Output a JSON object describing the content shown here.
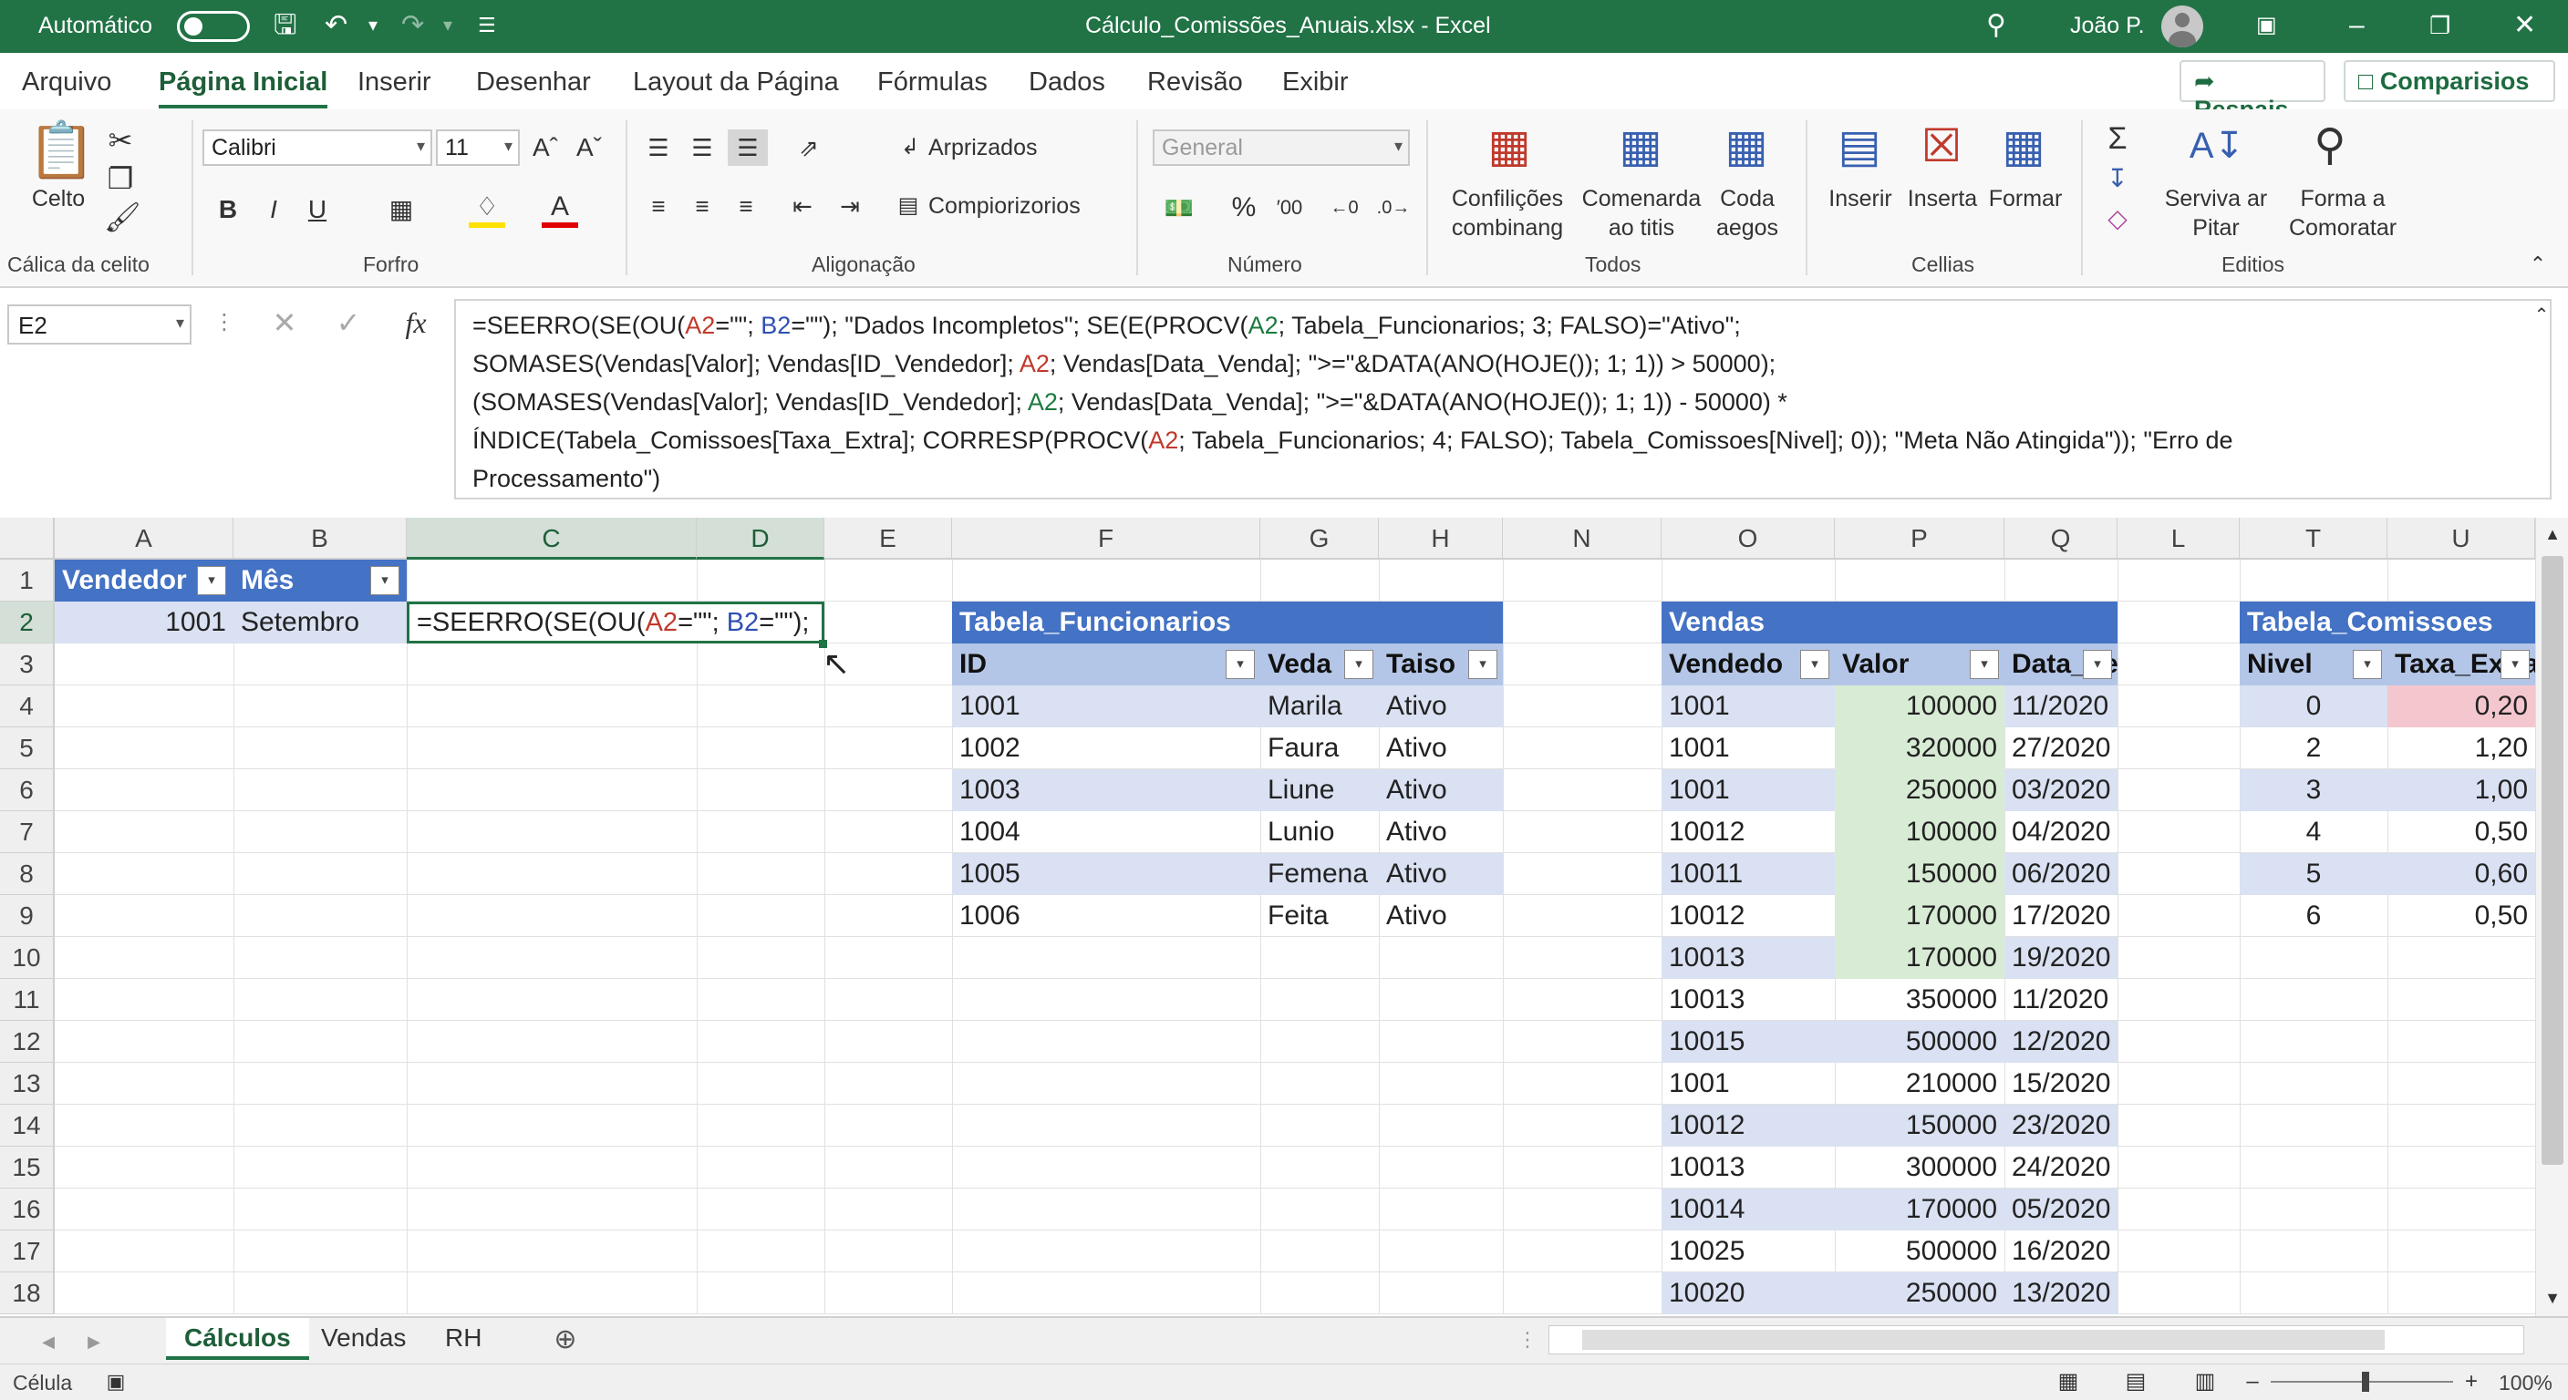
{
  "titlebar": {
    "autosave_label": "Automático",
    "file_title": "Cálculo_Comissões_Anuais.xlsx - Excel",
    "user_name": "João P."
  },
  "menu": {
    "tabs": [
      "Arquivo",
      "Página Inicial",
      "Inserir",
      "Desenhar",
      "Layout da Página",
      "Fórmulas",
      "Dados",
      "Revisão",
      "Exibir"
    ],
    "active": "Página Inicial",
    "share_label": "Respais",
    "comments_label": "Comparisios"
  },
  "ribbon": {
    "paste_label": "Celto",
    "clipboard_group": "Cálica da celito",
    "font_name": "Calibri",
    "font_size": "11",
    "font_group": "Forfro",
    "align_wrap": "Arprizados",
    "align_merge": "Compiorizorios",
    "align_group": "Aligonação",
    "number_format": "General",
    "number_group": "Número",
    "cond_format": "Confilições combinang",
    "format_table": "Comenarda ao titis",
    "cell_styles": "Coda aegos",
    "styles_group": "Todos",
    "insert": "Inserir",
    "delete": "Inserta",
    "format": "Formar",
    "cells_group": "Cellias",
    "sort_filter": "Serviva ar Pitar",
    "find_select": "Forma a Comoratar",
    "editing_group": "Editios",
    "bold": "B",
    "italic": "I",
    "underline": "U",
    "font_color": "A"
  },
  "formula_bar": {
    "name_box": "E2",
    "fx": "fx",
    "formula": "=SEERRO(SE(OU(A2=\"\"; B2=\"\"); \"Dados Incompletos\"; SE(E(PROCV(A2; Tabela_Funcionarios; 3; FALSO)=\"Ativo\";\nSOMASES(Vendas[Valor]; Vendas[ID_Vendedor]; A2; Vendas[Data_Venda]; \">=\"&DATA(ANO(HOJE()); 1; 1)) > 50000);\n(SOMASES(Vendas[Valor]; Vendas[ID_Vendedor]; A2; Vendas[Data_Venda]; \">=\"&DATA(ANO(HOJE()); 1; 1)) - 50000) *\nÍNDICE(Tabela_Comissoes[Taxa_Extra]; CORRESP(PROCV(A2; Tabela_Funcionarios; 4; FALSO); Tabela_Comissoes[Nivel]; 0)); \"Meta Não Atingida\")); \"Erro de\nProcessamento\")"
  },
  "grid": {
    "columns": [
      "A",
      "B",
      "C",
      "D",
      "E",
      "F",
      "G",
      "H",
      "N",
      "O",
      "P",
      "Q",
      "L",
      "T",
      "U"
    ],
    "rows": [
      "1",
      "2",
      "3",
      "4",
      "5",
      "6",
      "7",
      "8",
      "9",
      "10",
      "11",
      "12",
      "13",
      "14",
      "15",
      "16",
      "17",
      "18"
    ],
    "a1": "Vendedor",
    "b1": "Mês",
    "a2": "1001",
    "b2": "Setembro",
    "c2_edit": "=SEERRO(SE(OU(A2=\"\"; B2=\"\");"
  },
  "tabela_funcionarios": {
    "title": "Tabela_Funcionarios",
    "headers": [
      "ID",
      "Veda",
      "Taiso"
    ],
    "rows": [
      [
        "1001",
        "Marila",
        "Ativo"
      ],
      [
        "1002",
        "Faura",
        "Ativo"
      ],
      [
        "1003",
        "Liune",
        "Ativo"
      ],
      [
        "1004",
        "Lunio",
        "Ativo"
      ],
      [
        "1005",
        "Femena",
        "Ativo"
      ],
      [
        "1006",
        "Feita",
        "Ativo"
      ]
    ]
  },
  "vendas": {
    "title": "Vendas",
    "headers": [
      "Vendedo",
      "Valor",
      "Data_Venda"
    ],
    "rows": [
      [
        "1001",
        "100000",
        "11/2020"
      ],
      [
        "1001",
        "320000",
        "27/2020"
      ],
      [
        "1001",
        "250000",
        "03/2020"
      ],
      [
        "10012",
        "100000",
        "04/2020"
      ],
      [
        "10011",
        "150000",
        "06/2020"
      ],
      [
        "10012",
        "170000",
        "17/2020"
      ],
      [
        "10013",
        "170000",
        "19/2020"
      ],
      [
        "10013",
        "350000",
        "11/2020"
      ],
      [
        "10015",
        "500000",
        "12/2020"
      ],
      [
        "1001",
        "210000",
        "15/2020"
      ],
      [
        "10012",
        "150000",
        "23/2020"
      ],
      [
        "10013",
        "300000",
        "24/2020"
      ],
      [
        "10014",
        "170000",
        "05/2020"
      ],
      [
        "10025",
        "500000",
        "16/2020"
      ],
      [
        "10020",
        "250000",
        "13/2020"
      ]
    ]
  },
  "tabela_comissoes": {
    "title": "Tabela_Comissoes",
    "headers": [
      "Nivel",
      "Taxa_Extra"
    ],
    "rows": [
      [
        "0",
        "0,20"
      ],
      [
        "2",
        "1,20"
      ],
      [
        "3",
        "1,00"
      ],
      [
        "4",
        "0,50"
      ],
      [
        "5",
        "0,60"
      ],
      [
        "6",
        "0,50"
      ]
    ]
  },
  "sheets": {
    "tabs": [
      "Cálculos",
      "Vendas",
      "RH"
    ],
    "active": "Cálculos"
  },
  "status": {
    "mode": "Célula",
    "zoom": "100%"
  },
  "colors": {
    "excel_green": "#217346",
    "table_header": "#4472c4",
    "table_band": "#d9e1f2",
    "highlight_red": "#f4c7ce",
    "highlight_green": "#d8ecd5"
  }
}
